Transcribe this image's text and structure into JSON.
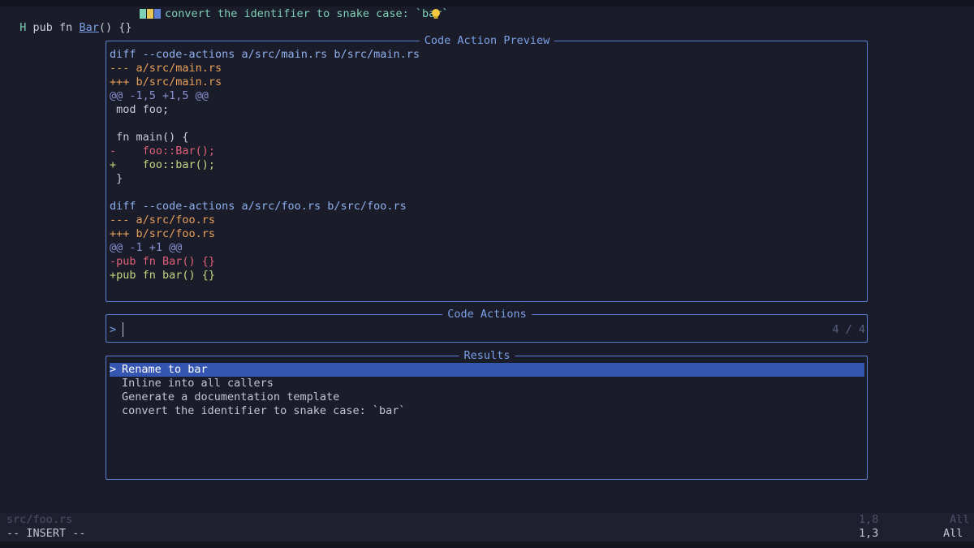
{
  "top": {
    "mark": "H",
    "code_prefix": "pub fn ",
    "code_ident": "Bar",
    "code_suffix": "() {}",
    "hint_text": "convert the identifier to snake case: `bar`",
    "bulb_icon": "lightbulb-icon"
  },
  "preview": {
    "title": "Code Action Preview",
    "lines": [
      {
        "cls": "c-head",
        "text": "diff --code-actions a/src/main.rs b/src/main.rs"
      },
      {
        "cls": "c-old",
        "text": "--- a/src/main.rs"
      },
      {
        "cls": "c-new",
        "text": "+++ b/src/main.rs"
      },
      {
        "cls": "c-hunk",
        "text": "@@ -1,5 +1,5 @@"
      },
      {
        "cls": "c-ctx",
        "text": " mod foo;"
      },
      {
        "cls": "c-ctx",
        "text": ""
      },
      {
        "cls": "c-ctx",
        "text": " fn main() {"
      },
      {
        "cls": "c-del",
        "text": "-    foo::Bar();"
      },
      {
        "cls": "c-add",
        "text": "+    foo::bar();"
      },
      {
        "cls": "c-ctx",
        "text": " }"
      },
      {
        "cls": "c-ctx",
        "text": ""
      },
      {
        "cls": "c-head",
        "text": "diff --code-actions a/src/foo.rs b/src/foo.rs"
      },
      {
        "cls": "c-old",
        "text": "--- a/src/foo.rs"
      },
      {
        "cls": "c-new",
        "text": "+++ b/src/foo.rs"
      },
      {
        "cls": "c-hunk",
        "text": "@@ -1 +1 @@"
      },
      {
        "cls": "c-del",
        "text": "-pub fn Bar() {}"
      },
      {
        "cls": "c-add",
        "text": "+pub fn bar() {}"
      }
    ]
  },
  "actions": {
    "title": "Code Actions",
    "prompt": ">",
    "query": "",
    "count": "4 / 4"
  },
  "results": {
    "title": "Results",
    "selected_marker": ">",
    "items": [
      "Rename to bar",
      "Inline into all callers",
      "Generate a documentation template",
      "convert the identifier to snake case: `bar`"
    ]
  },
  "statusline": {
    "filename": "src/foo.rs",
    "position": "1,8",
    "scroll": "All"
  },
  "modeline": {
    "mode": "-- INSERT --",
    "position": "1,3",
    "scroll": "All"
  },
  "colors": {
    "accent": "#5d7fd6",
    "selection": "#3456b0",
    "background": "#14161f"
  }
}
